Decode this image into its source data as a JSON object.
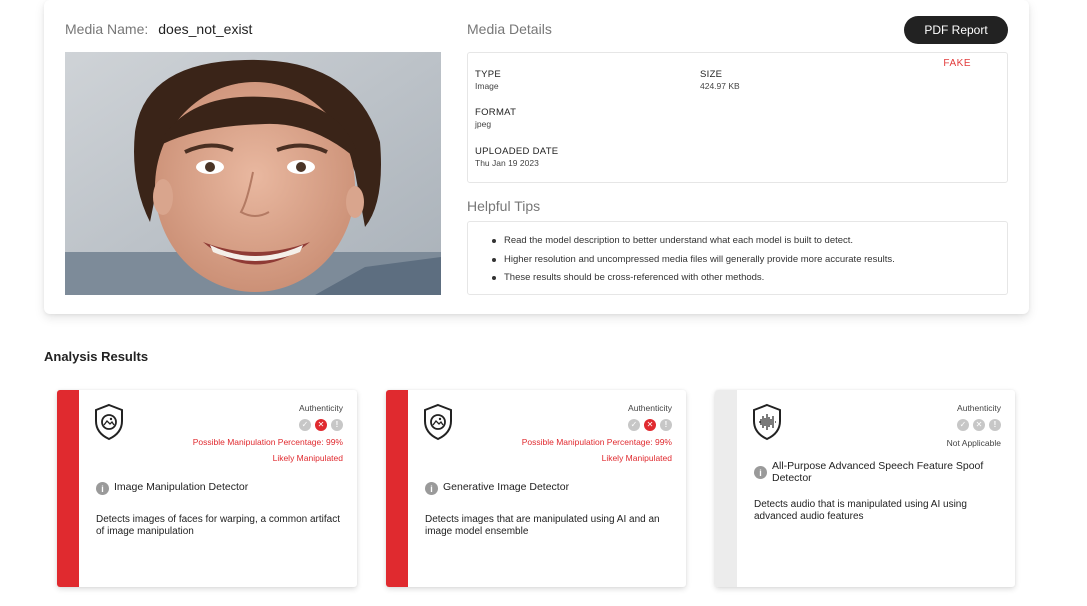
{
  "media": {
    "name_label": "Media Name:",
    "name_value": "does_not_exist"
  },
  "details": {
    "title": "Media Details",
    "pdf_button": "PDF Report",
    "verdict": "FAKE",
    "verdict_color": "#e23b3b",
    "fields": {
      "type_label": "TYPE",
      "type_value": "Image",
      "size_label": "SIZE",
      "size_value": "424.97 KB",
      "format_label": "FORMAT",
      "format_value": "jpeg",
      "uploaded_label": "UPLOADED DATE",
      "uploaded_value": "Thu Jan 19 2023"
    }
  },
  "tips": {
    "title": "Helpful Tips",
    "items": [
      "Read the model description to better understand what each model is built to detect.",
      "Higher resolution and uncompressed media files will generally provide more accurate results.",
      "These results should be cross-referenced with other methods."
    ]
  },
  "analysis": {
    "title": "Analysis Results",
    "accent_color": "#e02a2f",
    "cards": [
      {
        "authenticity_label": "Authenticity",
        "percentage_text": "Possible Manipulation Percentage: 99%",
        "verdict_text": "Likely Manipulated",
        "detector_name": "Image Manipulation Detector",
        "description": "Detects images of faces for warping, a common artifact of image manipulation",
        "icon": "image-shield-icon"
      },
      {
        "authenticity_label": "Authenticity",
        "percentage_text": "Possible Manipulation Percentage: 99%",
        "verdict_text": "Likely Manipulated",
        "detector_name": "Generative Image Detector",
        "description": "Detects images that are manipulated using AI and an image model ensemble",
        "icon": "image-shield-icon"
      },
      {
        "authenticity_label": "Authenticity",
        "status_text": "Not Applicable",
        "detector_name": "All-Purpose Advanced Speech Feature Spoof Detector",
        "description": "Detects audio that is manipulated using AI using advanced audio features",
        "icon": "audio-shield-icon"
      }
    ]
  }
}
